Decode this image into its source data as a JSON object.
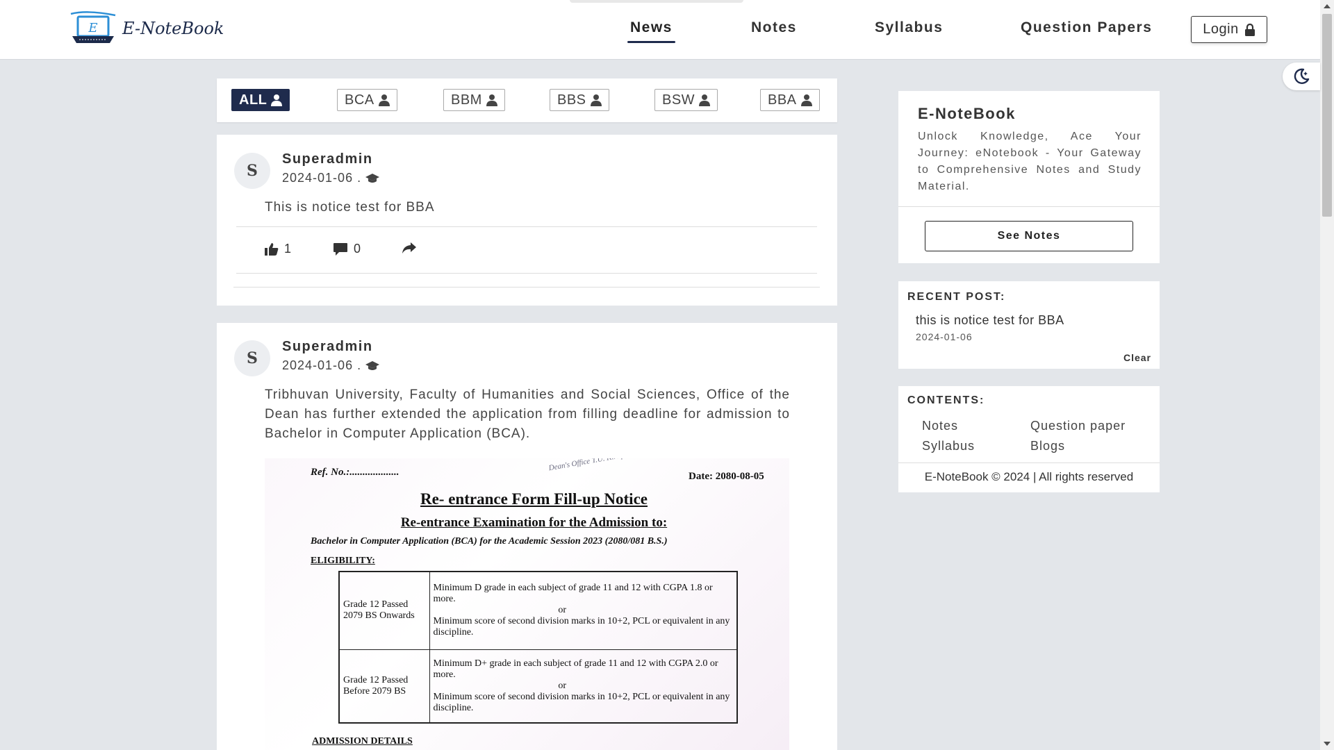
{
  "header": {
    "logo_text": "E-NoteBook",
    "nav": [
      {
        "label": "News",
        "active": true
      },
      {
        "label": "Notes",
        "active": false
      },
      {
        "label": "Syllabus",
        "active": false
      },
      {
        "label": "Question Papers",
        "active": false
      }
    ],
    "login_label": "Login"
  },
  "filters": [
    "ALL",
    "BCA",
    "BBM",
    "BBS",
    "BSW",
    "BBA"
  ],
  "posts": [
    {
      "avatar": "S",
      "author": "Superadmin",
      "date": "2024-01-06 .",
      "text": "This is notice test for BBA",
      "likes": "1",
      "comments": "0"
    },
    {
      "avatar": "S",
      "author": "Superadmin",
      "date": "2024-01-06 .",
      "text": "Tribhuvan University, Faculty of Humanities and Social Sciences, Office of the Dean has further extended the application from filling deadline for admission to Bachelor in Computer Application (BCA).",
      "notice": {
        "ref": "Ref. No.:...................",
        "date": "Date: 2080-08-05",
        "seal": "Dean's Office T.U. Kirtipur",
        "title": "Re- entrance Form Fill-up Notice",
        "subtitle": "Re-entrance Examination for the Admission to:",
        "program": "Bachelor in Computer Application (BCA) for the Academic Session 2023 (2080/081 B.S.)",
        "eligibility_label": "ELIGIBILITY:",
        "rows": [
          {
            "group": "Grade 12 Passed 2079 BS Onwards",
            "criteria_1": "Minimum D grade in each subject of grade 11 and 12 with CGPA 1.8 or more.",
            "or": "or",
            "criteria_2": "Minimum score of second division marks in 10+2, PCL or equivalent in any discipline."
          },
          {
            "group": "Grade 12 Passed Before 2079 BS",
            "criteria_1": "Minimum D+ grade in each subject of grade 11 and 12 with CGPA 2.0 or more.",
            "or": "or",
            "criteria_2": "Minimum score of second division marks in 10+2, PCL or equivalent in any discipline."
          }
        ],
        "admission_label": "ADMISSION DETAILS"
      }
    }
  ],
  "sidebar": {
    "about": {
      "title": "E-NoteBook",
      "description": "Unlock Knowledge, Ace Your Journey: eNotebook - Your Gateway to Comprehensive Notes and Study Material.",
      "button": "See Notes"
    },
    "recent": {
      "heading": "RECENT POST:",
      "title": "this is notice test for BBA",
      "date": "2024-01-06",
      "clear": "Clear"
    },
    "contents": {
      "heading": "CONTENTS:",
      "links": [
        "Notes",
        "Question paper",
        "Syllabus",
        "Blogs"
      ],
      "footer": "E-NoteBook © 2024 | All rights reserved"
    }
  },
  "colors": {
    "accent": "#1f2b4d",
    "background": "#e3e6ea"
  },
  "icons": [
    "logo-laptop-icon",
    "lock-icon",
    "moon-icon",
    "user-icon",
    "graduation-cap-icon",
    "thumbs-up-icon",
    "comment-icon",
    "share-icon"
  ]
}
